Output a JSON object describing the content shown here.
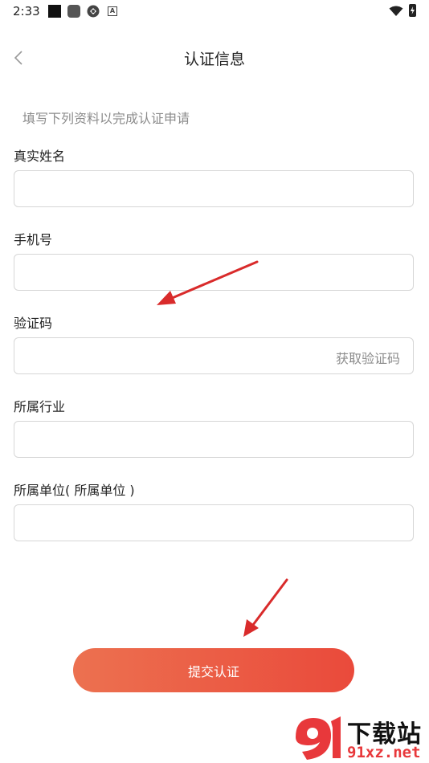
{
  "status_bar": {
    "time": "2:33",
    "icons": [
      "notification-square-icon",
      "notification-rounded-icon",
      "sync-icon",
      "a-icon",
      "wifi-icon",
      "battery-charging-icon"
    ]
  },
  "nav": {
    "back_icon": "chevron-left-icon",
    "title": "认证信息"
  },
  "form": {
    "hint": "填写下列资料以完成认证申请",
    "fields": [
      {
        "label": "真实姓名",
        "value": "",
        "placeholder": ""
      },
      {
        "label": "手机号",
        "value": "",
        "placeholder": ""
      },
      {
        "label": "验证码",
        "value": "",
        "placeholder": "",
        "action": "获取验证码"
      },
      {
        "label": "所属行业",
        "value": "",
        "placeholder": ""
      },
      {
        "label": "所属单位( 所属单位 )",
        "value": "",
        "placeholder": ""
      }
    ],
    "submit_label": "提交认证"
  },
  "annotations": {
    "arrow_color": "#d92b2b",
    "count": 2
  },
  "watermark": {
    "logo_text": "91",
    "title": "下载站",
    "domain": "91xz.net",
    "accent": "#e8383b"
  }
}
